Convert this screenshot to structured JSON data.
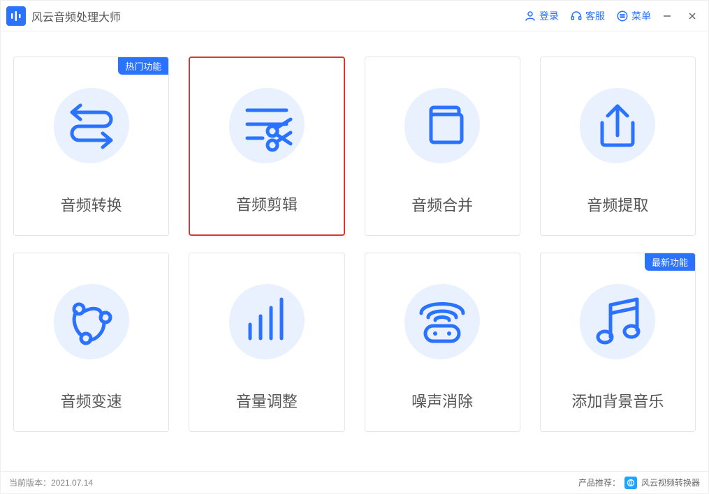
{
  "header": {
    "app_title": "风云音频处理大师",
    "login": "登录",
    "support": "客服",
    "menu": "菜单"
  },
  "cards": [
    {
      "label": "音频转换",
      "badge": "热门功能",
      "selected": false,
      "icon": "convert"
    },
    {
      "label": "音频剪辑",
      "badge": null,
      "selected": true,
      "icon": "cut"
    },
    {
      "label": "音频合并",
      "badge": null,
      "selected": false,
      "icon": "merge"
    },
    {
      "label": "音频提取",
      "badge": null,
      "selected": false,
      "icon": "extract"
    },
    {
      "label": "音频变速",
      "badge": null,
      "selected": false,
      "icon": "speed"
    },
    {
      "label": "音量调整",
      "badge": null,
      "selected": false,
      "icon": "volume"
    },
    {
      "label": "噪声消除",
      "badge": null,
      "selected": false,
      "icon": "denoise"
    },
    {
      "label": "添加背景音乐",
      "badge": "最新功能",
      "selected": false,
      "icon": "bgm"
    }
  ],
  "footer": {
    "version_prefix": "当前版本：",
    "version": "2021.07.14",
    "recommend_prefix": "产品推荐：",
    "recommend_name": "风云视频转换器"
  }
}
